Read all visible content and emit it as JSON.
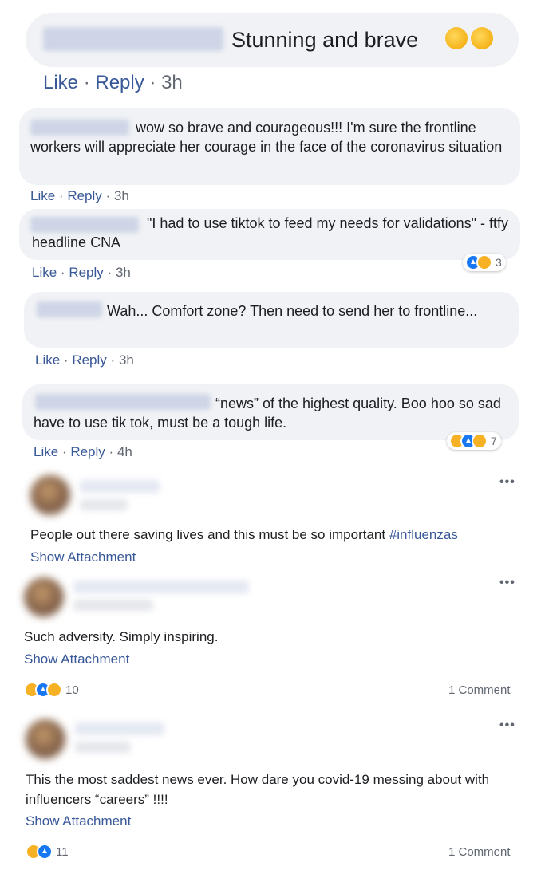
{
  "top_comment": {
    "text": "Stunning and brave",
    "emoji": "clapping-hands-icon",
    "actions": {
      "like": "Like",
      "reply": "Reply",
      "time": "3h",
      "sep": "·"
    }
  },
  "replies": [
    {
      "text": "wow so brave and courageous!!! I'm sure the frontline workers will appreciate her courage in the face of the coronavirus situation",
      "actions": {
        "like": "Like",
        "reply": "Reply",
        "time": "3h",
        "sep": "·"
      }
    },
    {
      "text": "\"I had to use tiktok to feed my needs for validations\" - ftfy headline CNA",
      "actions": {
        "like": "Like",
        "reply": "Reply",
        "time": "3h",
        "sep": "·"
      },
      "reactions": {
        "icons": [
          "like-icon",
          "haha-icon"
        ],
        "count": "3"
      }
    },
    {
      "text": "Wah... Comfort zone? Then need to send her to frontline...",
      "actions": {
        "like": "Like",
        "reply": "Reply",
        "time": "3h",
        "sep": "·"
      }
    },
    {
      "text": "“news” of the highest quality. Boo hoo so sad have to use tik tok, must be a tough life.",
      "actions": {
        "like": "Like",
        "reply": "Reply",
        "time": "4h",
        "sep": "·"
      },
      "reactions": {
        "icons": [
          "haha-icon",
          "like-icon",
          "sad-icon"
        ],
        "count": "7"
      }
    }
  ],
  "posts": [
    {
      "text_before_tag": "People out there saving lives and this must be so important ",
      "hashtag": "#influenzas",
      "show_attachment": "Show Attachment",
      "more": "•••"
    },
    {
      "text": "Such adversity. Simply inspiring.",
      "show_attachment": "Show Attachment",
      "more": "•••",
      "reactions": {
        "icons": [
          "haha-icon",
          "like-icon",
          "care-icon"
        ],
        "count": "10"
      },
      "comments": "1 Comment"
    },
    {
      "text": "This the most saddest news ever. How dare you covid-19 messing about with influencers “careers” !!!!",
      "show_attachment": "Show Attachment",
      "more": "•••",
      "reactions": {
        "icons": [
          "haha-icon",
          "like-icon"
        ],
        "count": "11"
      },
      "comments": "1 Comment"
    }
  ],
  "colors": {
    "link": "#385898",
    "bubble": "#f0f2f5",
    "like": "#1877f2",
    "emoji": "#f7b125"
  }
}
